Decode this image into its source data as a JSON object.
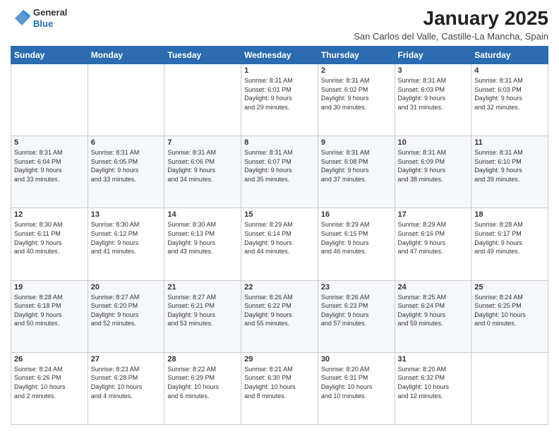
{
  "header": {
    "logo_general": "General",
    "logo_blue": "Blue",
    "main_title": "January 2025",
    "subtitle": "San Carlos del Valle, Castille-La Mancha, Spain"
  },
  "days_of_week": [
    "Sunday",
    "Monday",
    "Tuesday",
    "Wednesday",
    "Thursday",
    "Friday",
    "Saturday"
  ],
  "weeks": [
    {
      "cells": [
        {
          "num": "",
          "info": ""
        },
        {
          "num": "",
          "info": ""
        },
        {
          "num": "",
          "info": ""
        },
        {
          "num": "1",
          "info": "Sunrise: 8:31 AM\nSunset: 6:01 PM\nDaylight: 9 hours\nand 29 minutes."
        },
        {
          "num": "2",
          "info": "Sunrise: 8:31 AM\nSunset: 6:02 PM\nDaylight: 9 hours\nand 30 minutes."
        },
        {
          "num": "3",
          "info": "Sunrise: 8:31 AM\nSunset: 6:03 PM\nDaylight: 9 hours\nand 31 minutes."
        },
        {
          "num": "4",
          "info": "Sunrise: 8:31 AM\nSunset: 6:03 PM\nDaylight: 9 hours\nand 32 minutes."
        }
      ]
    },
    {
      "cells": [
        {
          "num": "5",
          "info": "Sunrise: 8:31 AM\nSunset: 6:04 PM\nDaylight: 9 hours\nand 33 minutes."
        },
        {
          "num": "6",
          "info": "Sunrise: 8:31 AM\nSunset: 6:05 PM\nDaylight: 9 hours\nand 33 minutes."
        },
        {
          "num": "7",
          "info": "Sunrise: 8:31 AM\nSunset: 6:06 PM\nDaylight: 9 hours\nand 34 minutes."
        },
        {
          "num": "8",
          "info": "Sunrise: 8:31 AM\nSunset: 6:07 PM\nDaylight: 9 hours\nand 35 minutes."
        },
        {
          "num": "9",
          "info": "Sunrise: 8:31 AM\nSunset: 6:08 PM\nDaylight: 9 hours\nand 37 minutes."
        },
        {
          "num": "10",
          "info": "Sunrise: 8:31 AM\nSunset: 6:09 PM\nDaylight: 9 hours\nand 38 minutes."
        },
        {
          "num": "11",
          "info": "Sunrise: 8:31 AM\nSunset: 6:10 PM\nDaylight: 9 hours\nand 39 minutes."
        }
      ]
    },
    {
      "cells": [
        {
          "num": "12",
          "info": "Sunrise: 8:30 AM\nSunset: 6:11 PM\nDaylight: 9 hours\nand 40 minutes."
        },
        {
          "num": "13",
          "info": "Sunrise: 8:30 AM\nSunset: 6:12 PM\nDaylight: 9 hours\nand 41 minutes."
        },
        {
          "num": "14",
          "info": "Sunrise: 8:30 AM\nSunset: 6:13 PM\nDaylight: 9 hours\nand 43 minutes."
        },
        {
          "num": "15",
          "info": "Sunrise: 8:29 AM\nSunset: 6:14 PM\nDaylight: 9 hours\nand 44 minutes."
        },
        {
          "num": "16",
          "info": "Sunrise: 8:29 AM\nSunset: 6:15 PM\nDaylight: 9 hours\nand 46 minutes."
        },
        {
          "num": "17",
          "info": "Sunrise: 8:29 AM\nSunset: 6:16 PM\nDaylight: 9 hours\nand 47 minutes."
        },
        {
          "num": "18",
          "info": "Sunrise: 8:28 AM\nSunset: 6:17 PM\nDaylight: 9 hours\nand 49 minutes."
        }
      ]
    },
    {
      "cells": [
        {
          "num": "19",
          "info": "Sunrise: 8:28 AM\nSunset: 6:18 PM\nDaylight: 9 hours\nand 50 minutes."
        },
        {
          "num": "20",
          "info": "Sunrise: 8:27 AM\nSunset: 6:20 PM\nDaylight: 9 hours\nand 52 minutes."
        },
        {
          "num": "21",
          "info": "Sunrise: 8:27 AM\nSunset: 6:21 PM\nDaylight: 9 hours\nand 53 minutes."
        },
        {
          "num": "22",
          "info": "Sunrise: 8:26 AM\nSunset: 6:22 PM\nDaylight: 9 hours\nand 55 minutes."
        },
        {
          "num": "23",
          "info": "Sunrise: 8:26 AM\nSunset: 6:23 PM\nDaylight: 9 hours\nand 57 minutes."
        },
        {
          "num": "24",
          "info": "Sunrise: 8:25 AM\nSunset: 6:24 PM\nDaylight: 9 hours\nand 59 minutes."
        },
        {
          "num": "25",
          "info": "Sunrise: 8:24 AM\nSunset: 6:25 PM\nDaylight: 10 hours\nand 0 minutes."
        }
      ]
    },
    {
      "cells": [
        {
          "num": "26",
          "info": "Sunrise: 8:24 AM\nSunset: 6:26 PM\nDaylight: 10 hours\nand 2 minutes."
        },
        {
          "num": "27",
          "info": "Sunrise: 8:23 AM\nSunset: 6:28 PM\nDaylight: 10 hours\nand 4 minutes."
        },
        {
          "num": "28",
          "info": "Sunrise: 8:22 AM\nSunset: 6:29 PM\nDaylight: 10 hours\nand 6 minutes."
        },
        {
          "num": "29",
          "info": "Sunrise: 8:21 AM\nSunset: 6:30 PM\nDaylight: 10 hours\nand 8 minutes."
        },
        {
          "num": "30",
          "info": "Sunrise: 8:20 AM\nSunset: 6:31 PM\nDaylight: 10 hours\nand 10 minutes."
        },
        {
          "num": "31",
          "info": "Sunrise: 8:20 AM\nSunset: 6:32 PM\nDaylight: 10 hours\nand 12 minutes."
        },
        {
          "num": "",
          "info": ""
        }
      ]
    }
  ]
}
